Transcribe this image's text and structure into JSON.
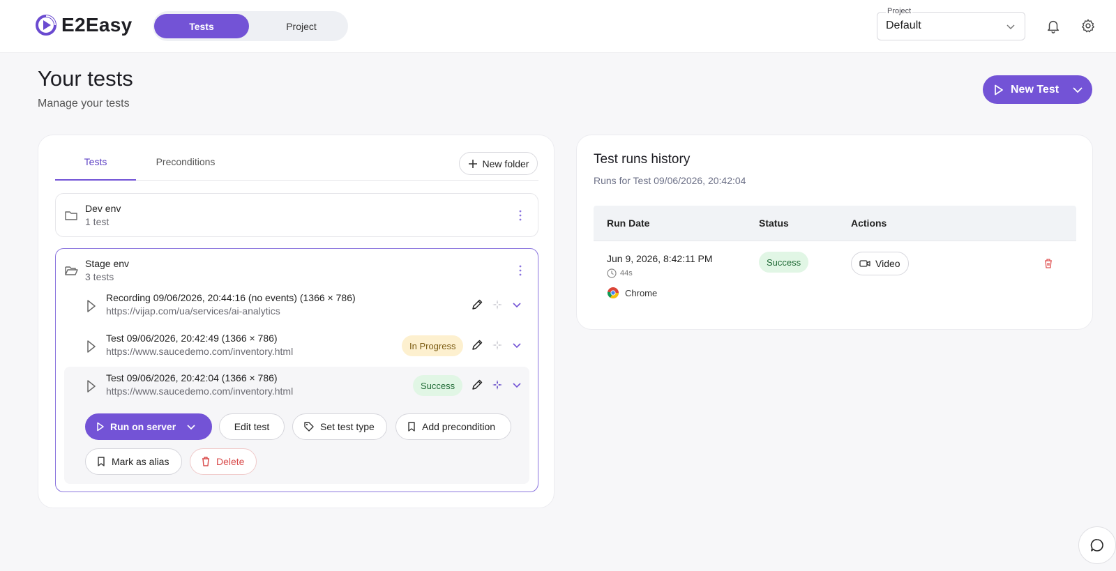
{
  "app": {
    "name": "E2Easy"
  },
  "nav": {
    "tabs": [
      {
        "label": "Tests"
      },
      {
        "label": "Project"
      }
    ]
  },
  "project_select": {
    "label": "Project",
    "value": "Default"
  },
  "page": {
    "title": "Your tests",
    "subtitle": "Manage your tests",
    "new_test_label": "New Test"
  },
  "tests_panel": {
    "tabs": [
      {
        "label": "Tests"
      },
      {
        "label": "Preconditions"
      }
    ],
    "new_folder_label": "New folder",
    "folders": [
      {
        "name": "Dev env",
        "count": "1 test"
      },
      {
        "name": "Stage env",
        "count": "3 tests",
        "tests": [
          {
            "title": "Recording 09/06/2026, 20:44:16 (no events) (1366 × 786)",
            "url": "https://vijap.com/ua/services/ai-analytics"
          },
          {
            "title": "Test 09/06/2026, 20:42:49 (1366 × 786)",
            "url": "https://www.saucedemo.com/inventory.html",
            "status": "In Progress"
          },
          {
            "title": "Test 09/06/2026, 20:42:04 (1366 × 786)",
            "url": "https://www.saucedemo.com/inventory.html",
            "status": "Success"
          }
        ]
      }
    ],
    "actions": {
      "run_on_server": "Run on server",
      "edit_test": "Edit test",
      "set_test_type": "Set test type",
      "add_precondition": "Add precondition",
      "mark_as_alias": "Mark as alias",
      "delete": "Delete"
    }
  },
  "history": {
    "title": "Test runs history",
    "subtitle": "Runs for Test 09/06/2026, 20:42:04",
    "columns": [
      "Run Date",
      "Status",
      "Actions"
    ],
    "rows": [
      {
        "date": "Jun 9, 2026, 8:42:11 PM",
        "duration": "44s",
        "browser": "Chrome",
        "status": "Success",
        "action": "Video"
      }
    ]
  },
  "colors": {
    "accent": "#7353d6",
    "success_bg": "#e1f6e5",
    "progress_bg": "#fdf0cf",
    "danger": "#d94c4c"
  }
}
